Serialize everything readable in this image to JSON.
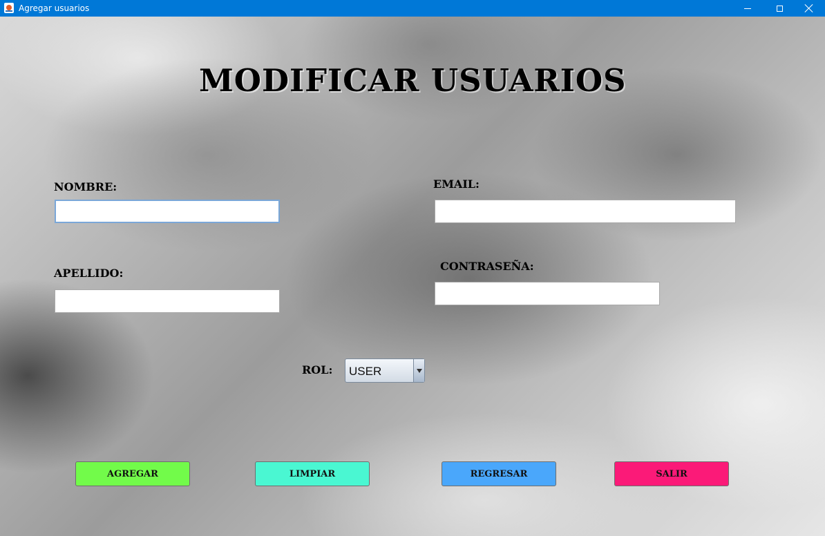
{
  "window": {
    "title": "Agregar usuarios",
    "controls": [
      "minimize-icon",
      "maximize-icon",
      "close-icon"
    ],
    "titlebar_color": "#0078d7"
  },
  "form": {
    "heading": "MODIFICAR USUARIOS",
    "nombre": {
      "label": "NOMBRE:",
      "value": ""
    },
    "apellido": {
      "label": "APELLIDO:",
      "value": ""
    },
    "email": {
      "label": "EMAIL:",
      "value": ""
    },
    "contrasena": {
      "label": "CONTRASEÑA:",
      "value": ""
    },
    "rol": {
      "label": "ROL:",
      "selected": "USER"
    }
  },
  "buttons": {
    "agregar": {
      "label": "AGREGAR",
      "color": "#72fb4a"
    },
    "limpiar": {
      "label": "LIMPIAR",
      "color": "#4af7d2"
    },
    "regresar": {
      "label": "REGRESAR",
      "color": "#4aa7fb"
    },
    "salir": {
      "label": "SALIR",
      "color": "#fb1a78"
    }
  }
}
